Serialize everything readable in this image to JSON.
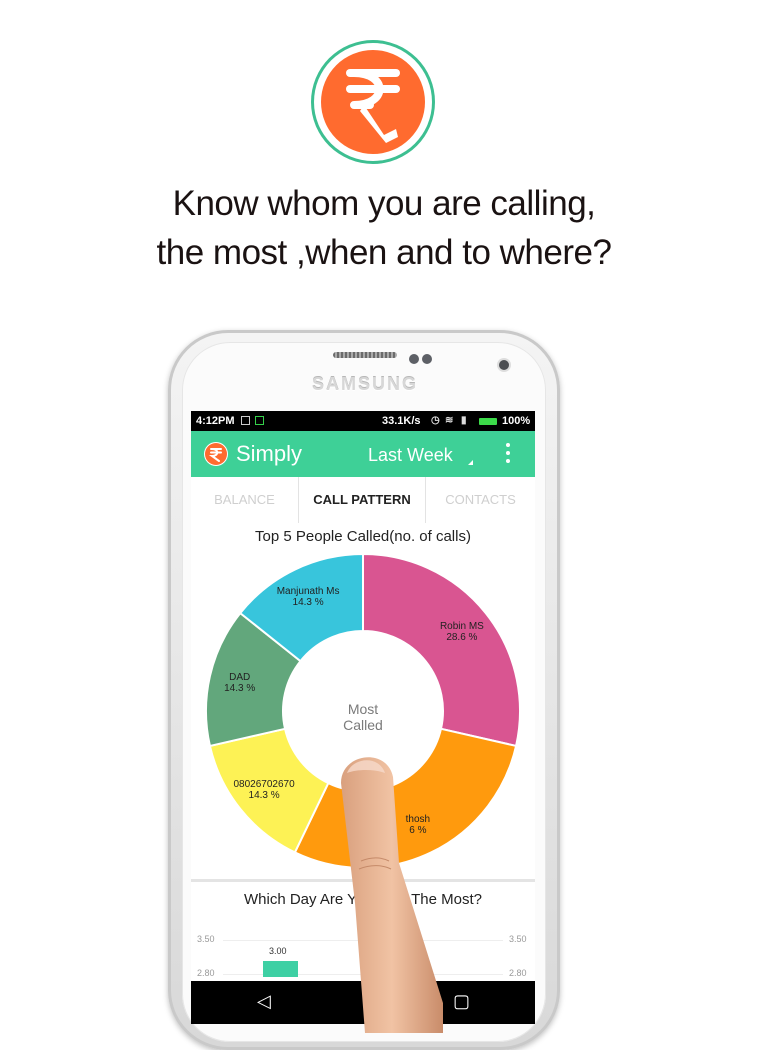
{
  "promo": {
    "headline_line1": "Know whom you are calling,",
    "headline_line2": "the most ,when and to where?"
  },
  "device": {
    "brand": "SAMSUNG"
  },
  "status_bar": {
    "time": "4:12PM",
    "network_rate": "33.1K/s",
    "battery": "100%"
  },
  "app_bar": {
    "title": "Simply",
    "period": "Last Week"
  },
  "tabs": [
    {
      "label": "BALANCE",
      "active": false
    },
    {
      "label": "CALL PATTERN",
      "active": true
    },
    {
      "label": "CONTACTS",
      "active": false
    }
  ],
  "top_people_card": {
    "title": "Top 5 People Called(no. of calls)",
    "center_line1": "Most",
    "center_line2": "Called"
  },
  "chart_data": [
    {
      "type": "pie",
      "title": "Top 5 People Called(no. of calls)",
      "categories": [
        "Robin MS",
        "Santhosh",
        "08026702670",
        "DAD",
        "Manjunath Ms"
      ],
      "values": [
        28.6,
        28.6,
        14.3,
        14.3,
        14.3
      ],
      "visible_labels": [
        "Robin MS",
        "thosh",
        "08026702670",
        "DAD",
        "Manjunath Ms"
      ],
      "visible_value_labels": [
        "28.6 %",
        "6 %",
        "14.3 %",
        "14.3 %",
        "14.3 %"
      ],
      "colors": [
        "#d95591",
        "#ff9a0d",
        "#fdf255",
        "#62a77c",
        "#38c5dc"
      ]
    },
    {
      "type": "bar",
      "title": "Which Day Are You Calling The Most?",
      "visible_title_left": "Which Day Are Y",
      "visible_title_right": "The Most?",
      "ylim": [
        2.8,
        3.5
      ],
      "y_ticks": [
        "3.50",
        "2.80"
      ],
      "values": [
        3.0
      ],
      "value_labels": [
        "3.00"
      ],
      "color": "#3ed0a4"
    }
  ],
  "colors": {
    "brand_orange": "#ff6b2f",
    "brand_green": "#3ed097",
    "logo_ring": "#3dbf91"
  },
  "icons": [
    "rupee-phone-logo-icon",
    "overflow-menu-icon",
    "back-nav-icon",
    "home-nav-icon",
    "recents-nav-icon"
  ]
}
